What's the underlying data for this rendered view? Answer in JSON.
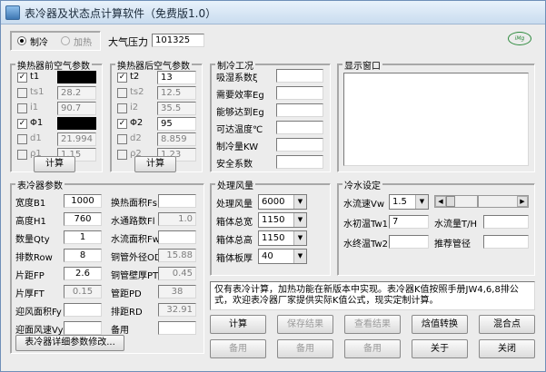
{
  "window": {
    "title": "表冷器及状态点计算软件（免费版1.0）"
  },
  "mode": {
    "cooling": "制冷",
    "heating": "加热",
    "selected": "cooling"
  },
  "pressure": {
    "label": "大气压力",
    "value": "101325"
  },
  "logo": {
    "text": "iMg"
  },
  "front_air": {
    "title": "换热器前空气参数",
    "rows": [
      {
        "label": "t1",
        "checked": true,
        "enabled": true,
        "value": ""
      },
      {
        "label": "ts1",
        "checked": false,
        "enabled": false,
        "value": "28.2"
      },
      {
        "label": "i1",
        "checked": false,
        "enabled": false,
        "value": "90.7"
      },
      {
        "label": "Φ1",
        "checked": true,
        "enabled": true,
        "value": ""
      },
      {
        "label": "d1",
        "checked": false,
        "enabled": false,
        "value": "21.994"
      },
      {
        "label": "ρ1",
        "checked": false,
        "enabled": false,
        "value": "1.15"
      }
    ],
    "calc": "计算"
  },
  "rear_air": {
    "title": "换热器后空气参数",
    "rows": [
      {
        "label": "t2",
        "checked": true,
        "enabled": true,
        "value": "13"
      },
      {
        "label": "ts2",
        "checked": false,
        "enabled": false,
        "value": "12.5"
      },
      {
        "label": "i2",
        "checked": false,
        "enabled": false,
        "value": "35.5"
      },
      {
        "label": "Φ2",
        "checked": true,
        "enabled": true,
        "value": "95"
      },
      {
        "label": "d2",
        "checked": false,
        "enabled": false,
        "value": "8.859"
      },
      {
        "label": "ρ2",
        "checked": false,
        "enabled": false,
        "value": "1.23"
      }
    ],
    "calc": "计算"
  },
  "cooling": {
    "title": "制冷工况",
    "rows": [
      {
        "label": "吸湿系数ξ",
        "value": ""
      },
      {
        "label": "需要效率Eg",
        "value": ""
      },
      {
        "label": "能够达到Eg",
        "value": ""
      },
      {
        "label": "可达温度℃",
        "value": ""
      },
      {
        "label": "制冷量KW",
        "value": ""
      },
      {
        "label": "安全系数",
        "value": ""
      }
    ]
  },
  "display": {
    "title": "显示窗口"
  },
  "cooler": {
    "title": "表冷器参数",
    "left": [
      {
        "label": "宽度B1",
        "value": "1000",
        "enabled": true
      },
      {
        "label": "高度H1",
        "value": "760",
        "enabled": true
      },
      {
        "label": "数量Qty",
        "value": "1",
        "enabled": true
      },
      {
        "label": "排数Row",
        "value": "8",
        "enabled": true
      },
      {
        "label": "片距FP",
        "value": "2.6",
        "enabled": true
      },
      {
        "label": "片厚FT",
        "value": "0.15",
        "enabled": false
      },
      {
        "label": "迎风面积Fy",
        "value": "",
        "enabled": true
      },
      {
        "label": "迎面风速Vy",
        "value": "",
        "enabled": true
      }
    ],
    "right": [
      {
        "label": "换热面积Fs",
        "value": "",
        "enabled": true
      },
      {
        "label": "水通路数Fl",
        "value": "1.0",
        "enabled": false
      },
      {
        "label": "水流面积Fw",
        "value": "",
        "enabled": true
      },
      {
        "label": "铜管外径OD",
        "value": "15.88",
        "enabled": false
      },
      {
        "label": "铜管壁厚PT",
        "value": "0.45",
        "enabled": false
      },
      {
        "label": "管距PD",
        "value": "38",
        "enabled": false
      },
      {
        "label": "排距RD",
        "value": "32.91",
        "enabled": false
      },
      {
        "label": "备用",
        "value": "",
        "enabled": true
      }
    ],
    "detail_button": "表冷器详细参数修改..."
  },
  "air_handling": {
    "title": "处理风量",
    "rows": [
      {
        "label": "处理风量",
        "value": "6000"
      },
      {
        "label": "箱体总宽",
        "value": "1150"
      },
      {
        "label": "箱体总高",
        "value": "1150"
      },
      {
        "label": "箱体板厚",
        "value": "40"
      }
    ]
  },
  "chilled_water": {
    "title": "冷水设定",
    "flow_speed_label": "水流速Vw",
    "flow_speed_value": "1.5",
    "slider_level": 0.0,
    "inlet_label": "水初温Tw1",
    "inlet_value": "7",
    "flow_label": "水流量T/H",
    "flow_value": "",
    "outlet_label": "水终温Tw2",
    "outlet_value": "",
    "pipe_label": "推荐管径",
    "pipe_value": ""
  },
  "note": {
    "text": "仅有表冷计算，加热功能在新版本中实现。表冷器K值按照手册JW4,6,8排公式，欢迎表冷器厂家提供实际K值公式，现实定制计算。"
  },
  "buttons": {
    "row1": [
      {
        "label": "计算",
        "enabled": true
      },
      {
        "label": "保存结果",
        "enabled": false
      },
      {
        "label": "查看结果",
        "enabled": false
      },
      {
        "label": "焓值转换",
        "enabled": true
      },
      {
        "label": "混合点",
        "enabled": true
      }
    ],
    "row2": [
      {
        "label": "备用",
        "enabled": false
      },
      {
        "label": "备用",
        "enabled": false
      },
      {
        "label": "备用",
        "enabled": false
      },
      {
        "label": "关于",
        "enabled": true
      },
      {
        "label": "关闭",
        "enabled": true
      }
    ]
  }
}
